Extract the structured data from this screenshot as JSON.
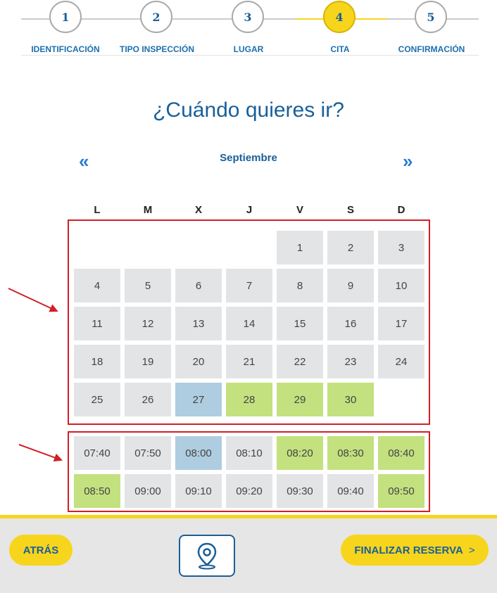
{
  "steps": [
    {
      "number": "1",
      "label": "IDENTIFICACIÓN",
      "active": false
    },
    {
      "number": "2",
      "label": "TIPO INSPECCIÓN",
      "active": false
    },
    {
      "number": "3",
      "label": "LUGAR",
      "active": false
    },
    {
      "number": "4",
      "label": "CITA",
      "active": true
    },
    {
      "number": "5",
      "label": "CONFIRMACIÓN",
      "active": false
    }
  ],
  "page_title": "¿Cuándo quieres ir?",
  "calendar": {
    "month": "Septiembre",
    "prev_icon": "double-chevron-left-icon",
    "next_icon": "double-chevron-right-icon",
    "weekdays": [
      "L",
      "M",
      "X",
      "J",
      "V",
      "S",
      "D"
    ],
    "days": [
      {
        "label": "1",
        "state": "unavailable"
      },
      {
        "label": "2",
        "state": "unavailable"
      },
      {
        "label": "3",
        "state": "unavailable"
      },
      {
        "label": "4",
        "state": "unavailable"
      },
      {
        "label": "5",
        "state": "unavailable"
      },
      {
        "label": "6",
        "state": "unavailable"
      },
      {
        "label": "7",
        "state": "unavailable"
      },
      {
        "label": "8",
        "state": "unavailable"
      },
      {
        "label": "9",
        "state": "unavailable"
      },
      {
        "label": "10",
        "state": "unavailable"
      },
      {
        "label": "11",
        "state": "unavailable"
      },
      {
        "label": "12",
        "state": "unavailable"
      },
      {
        "label": "13",
        "state": "unavailable"
      },
      {
        "label": "14",
        "state": "unavailable"
      },
      {
        "label": "15",
        "state": "unavailable"
      },
      {
        "label": "16",
        "state": "unavailable"
      },
      {
        "label": "17",
        "state": "unavailable"
      },
      {
        "label": "18",
        "state": "unavailable"
      },
      {
        "label": "19",
        "state": "unavailable"
      },
      {
        "label": "20",
        "state": "unavailable"
      },
      {
        "label": "21",
        "state": "unavailable"
      },
      {
        "label": "22",
        "state": "unavailable"
      },
      {
        "label": "23",
        "state": "unavailable"
      },
      {
        "label": "24",
        "state": "unavailable"
      },
      {
        "label": "25",
        "state": "unavailable"
      },
      {
        "label": "26",
        "state": "unavailable"
      },
      {
        "label": "27",
        "state": "selected"
      },
      {
        "label": "28",
        "state": "available"
      },
      {
        "label": "29",
        "state": "available"
      },
      {
        "label": "30",
        "state": "available"
      }
    ]
  },
  "times": [
    {
      "label": "07:40",
      "state": "unavailable"
    },
    {
      "label": "07:50",
      "state": "unavailable"
    },
    {
      "label": "08:00",
      "state": "selected"
    },
    {
      "label": "08:10",
      "state": "unavailable"
    },
    {
      "label": "08:20",
      "state": "available"
    },
    {
      "label": "08:30",
      "state": "available"
    },
    {
      "label": "08:40",
      "state": "available"
    },
    {
      "label": "08:50",
      "state": "available"
    },
    {
      "label": "09:00",
      "state": "unavailable"
    },
    {
      "label": "09:10",
      "state": "unavailable"
    },
    {
      "label": "09:20",
      "state": "unavailable"
    },
    {
      "label": "09:30",
      "state": "unavailable"
    },
    {
      "label": "09:40",
      "state": "unavailable"
    },
    {
      "label": "09:50",
      "state": "available"
    }
  ],
  "footer": {
    "back_label": "ATRÁS",
    "map_icon": "map-pin-icon",
    "finish_label": "FINALIZAR RESERVA",
    "finish_suffix": ">"
  },
  "colors": {
    "accent_yellow": "#f7d51d",
    "brand_blue": "#1a5f97",
    "available_green": "#c3e17f",
    "selected_blue": "#afcde0",
    "unavailable_gray": "#e3e4e6",
    "annotation_red": "#d21f27"
  }
}
